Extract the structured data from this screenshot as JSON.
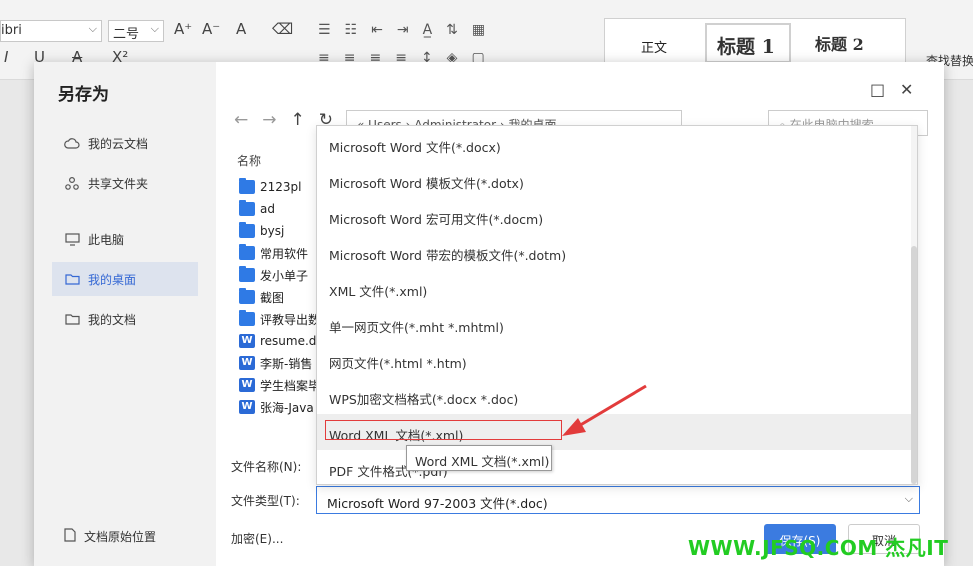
{
  "ribbon": {
    "font_name": "ibri",
    "font_size": "二号",
    "styles": {
      "normal": "正文",
      "heading1": "标题 1",
      "heading2": "标题 2"
    },
    "find_replace": "查找替换"
  },
  "dialog": {
    "title": "另存为",
    "sidebar": [
      {
        "label": "我的云文档",
        "icon": "cloud-icon"
      },
      {
        "label": "共享文件夹",
        "icon": "share-icon"
      },
      {
        "label": "此电脑",
        "icon": "monitor-icon"
      },
      {
        "label": "我的桌面",
        "icon": "folder-icon",
        "active": true
      },
      {
        "label": "我的文档",
        "icon": "folder-icon"
      }
    ],
    "sidebar_bottom": "文档原始位置",
    "path": [
      "Users",
      "Administrator",
      "我的桌面"
    ],
    "search_placeholder": "在此电脑中搜索",
    "column_name": "名称",
    "files": [
      {
        "name": "2123pl",
        "type": "folder"
      },
      {
        "name": "ad",
        "type": "folder"
      },
      {
        "name": "bysj",
        "type": "folder"
      },
      {
        "name": "常用软件",
        "type": "folder"
      },
      {
        "name": "发小单子",
        "type": "folder"
      },
      {
        "name": "截图",
        "type": "folder"
      },
      {
        "name": "评教导出数",
        "type": "folder"
      },
      {
        "name": "resume.d",
        "type": "word"
      },
      {
        "name": "李斯-销售",
        "type": "word"
      },
      {
        "name": "学生档案毕",
        "type": "word"
      },
      {
        "name": "张海-Java",
        "type": "word"
      }
    ],
    "file_name_label": "文件名称(N):",
    "file_type_label": "文件类型(T):",
    "file_type_value": "Microsoft Word 97-2003 文件(*.doc)",
    "encrypt_label": "加密(E)...",
    "save_label": "保存(S)",
    "cancel_label": "取消"
  },
  "dropdown": {
    "options": [
      "Microsoft Word 文件(*.docx)",
      "Microsoft Word 模板文件(*.dotx)",
      "Microsoft Word 宏可用文件(*.docm)",
      "Microsoft Word 带宏的模板文件(*.dotm)",
      "XML 文件(*.xml)",
      "单一网页文件(*.mht *.mhtml)",
      "网页文件(*.html *.htm)",
      "WPS加密文档格式(*.docx *.doc)",
      "Word XML 文档(*.xml)",
      "PDF 文件格式(*.pdf)"
    ],
    "tooltip": "Word XML 文档(*.xml)"
  },
  "watermark": "WWW.JFSQ.COM 杰凡IT",
  "colors": {
    "accent": "#3b7be0",
    "highlight_box": "#e23b3b",
    "watermark": "#22cc22"
  }
}
